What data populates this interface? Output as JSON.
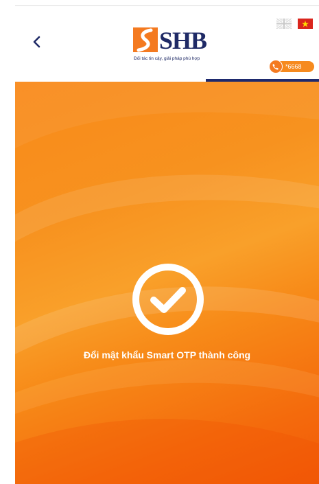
{
  "header": {
    "brand_name": "SHB",
    "brand_tagline": "Đối tác tin cậy, giải pháp phù hợp",
    "hotline": "*6668"
  },
  "languages": [
    "English",
    "Tiếng Việt"
  ],
  "main": {
    "message": "Đổi mật khẩu Smart OTP thành công"
  },
  "colors": {
    "brand_blue": "#1f2a66",
    "brand_orange": "#f47a20",
    "background_orange": "#f7921f"
  },
  "icons": {
    "back": "chevron-left-icon",
    "success": "check-circle-icon",
    "hotline": "phone-icon"
  }
}
